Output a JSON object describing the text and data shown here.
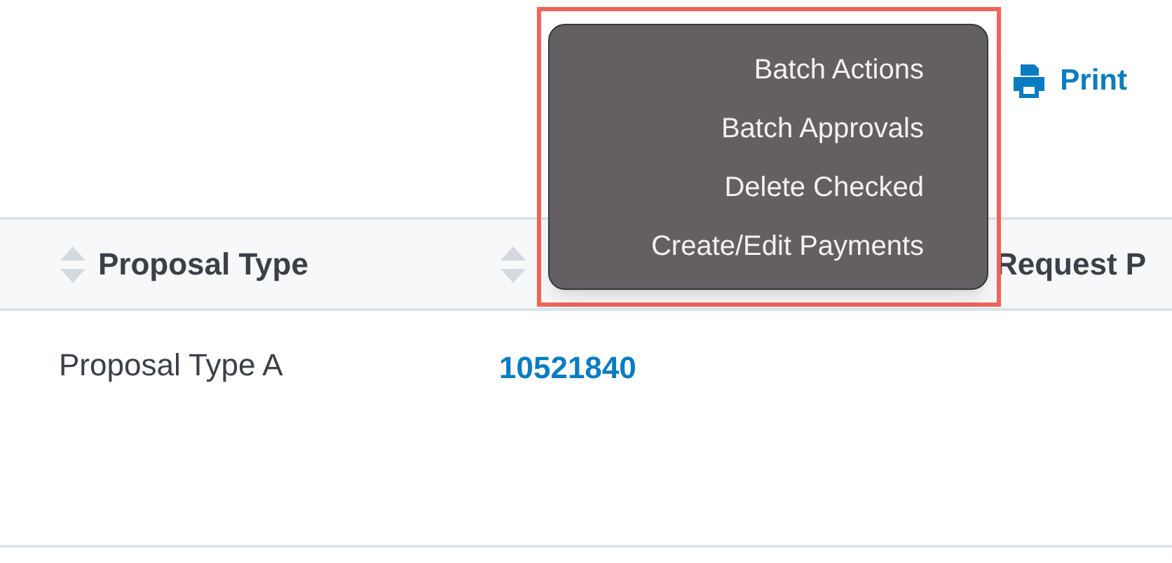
{
  "toolbar": {
    "print": {
      "label": "Print"
    }
  },
  "table": {
    "columns": [
      {
        "label": "Proposal Type",
        "sortable": true
      },
      {
        "sortable": true
      },
      {
        "label": "Request P",
        "sortable": false
      }
    ],
    "rows": [
      {
        "cells": [
          {
            "kind": "text",
            "text": "Proposal Type A"
          },
          {
            "kind": "link",
            "text": "10521840"
          }
        ]
      }
    ]
  },
  "context_menu": {
    "highlighted": true,
    "items": [
      {
        "label": "Batch Actions"
      },
      {
        "label": "Batch Approvals"
      },
      {
        "label": "Delete Checked"
      },
      {
        "label": "Create/Edit Payments"
      }
    ]
  }
}
